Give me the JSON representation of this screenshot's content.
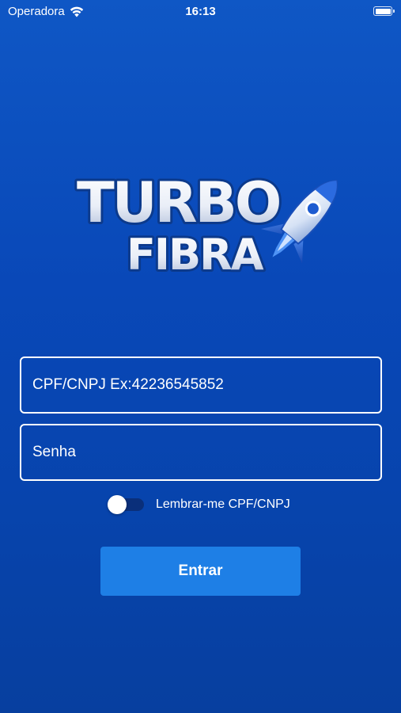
{
  "status_bar": {
    "carrier": "Operadora",
    "time": "16:13",
    "battery_level": 1.0
  },
  "logo": {
    "line1": "TURBO",
    "line2": "FIBRA"
  },
  "login_form": {
    "cpf_placeholder": "CPF/CNPJ Ex:42236545852",
    "cpf_value": "",
    "password_placeholder": "Senha",
    "password_value": "",
    "remember_label": "Lembrar-me CPF/CNPJ",
    "remember_on": false,
    "submit_label": "Entrar"
  },
  "colors": {
    "background": "#0948b8",
    "button": "#1e7fe6",
    "toggle_track": "#0a2f7a",
    "text": "#ffffff"
  }
}
